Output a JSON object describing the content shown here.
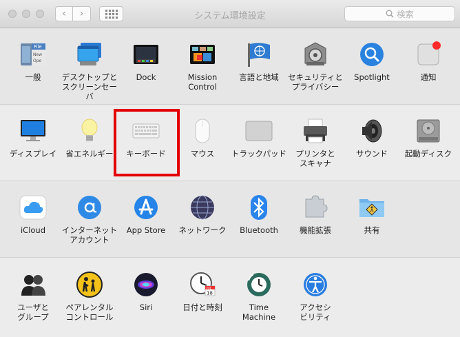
{
  "window": {
    "title": "システム環境設定"
  },
  "toolbar": {
    "back_label": "‹",
    "forward_label": "›",
    "search_placeholder": "検索"
  },
  "rows": [
    {
      "items": [
        {
          "id": "general",
          "label": "一般",
          "icon": "general-icon"
        },
        {
          "id": "desktop",
          "label": "デスクトップと\nスクリーンセーバ",
          "icon": "desktop-screensaver-icon"
        },
        {
          "id": "dock",
          "label": "Dock",
          "icon": "dock-icon"
        },
        {
          "id": "mission",
          "label": "Mission\nControl",
          "icon": "mission-control-icon"
        },
        {
          "id": "language",
          "label": "言語と地域",
          "icon": "language-region-icon"
        },
        {
          "id": "security",
          "label": "セキュリティと\nプライバシー",
          "icon": "security-privacy-icon"
        },
        {
          "id": "spotlight",
          "label": "Spotlight",
          "icon": "spotlight-icon"
        },
        {
          "id": "notifications",
          "label": "通知",
          "icon": "notifications-icon"
        }
      ]
    },
    {
      "items": [
        {
          "id": "displays",
          "label": "ディスプレイ",
          "icon": "display-icon"
        },
        {
          "id": "energy",
          "label": "省エネルギー",
          "icon": "energy-saver-icon"
        },
        {
          "id": "keyboard",
          "label": "キーボード",
          "icon": "keyboard-icon"
        },
        {
          "id": "mouse",
          "label": "マウス",
          "icon": "mouse-icon"
        },
        {
          "id": "trackpad",
          "label": "トラックパッド",
          "icon": "trackpad-icon"
        },
        {
          "id": "printers",
          "label": "プリンタと\nスキャナ",
          "icon": "printer-icon"
        },
        {
          "id": "sound",
          "label": "サウンド",
          "icon": "sound-icon"
        },
        {
          "id": "startup",
          "label": "起動ディスク",
          "icon": "startup-disk-icon"
        }
      ]
    },
    {
      "items": [
        {
          "id": "icloud",
          "label": "iCloud",
          "icon": "icloud-icon"
        },
        {
          "id": "internet",
          "label": "インターネット\nアカウント",
          "icon": "internet-accounts-icon"
        },
        {
          "id": "appstore",
          "label": "App Store",
          "icon": "app-store-icon"
        },
        {
          "id": "network",
          "label": "ネットワーク",
          "icon": "network-icon"
        },
        {
          "id": "bluetooth",
          "label": "Bluetooth",
          "icon": "bluetooth-icon"
        },
        {
          "id": "extensions",
          "label": "機能拡張",
          "icon": "extensions-icon"
        },
        {
          "id": "sharing",
          "label": "共有",
          "icon": "sharing-icon"
        }
      ]
    },
    {
      "items": [
        {
          "id": "users",
          "label": "ユーザと\nグループ",
          "icon": "users-groups-icon"
        },
        {
          "id": "parental",
          "label": "ペアレンタル\nコントロール",
          "icon": "parental-controls-icon"
        },
        {
          "id": "siri",
          "label": "Siri",
          "icon": "siri-icon"
        },
        {
          "id": "datetime",
          "label": "日付と時刻",
          "icon": "date-time-icon"
        },
        {
          "id": "timemachine",
          "label": "Time\nMachine",
          "icon": "time-machine-icon"
        },
        {
          "id": "accessibility",
          "label": "アクセシ\nビリティ",
          "icon": "accessibility-icon"
        }
      ]
    }
  ],
  "icon_text": {
    "general_file": "File",
    "general_new": "New",
    "general_open": "Ope",
    "calendar_month": "JUL",
    "calendar_day": "18"
  },
  "colors": {
    "highlight": "#e30000",
    "notification_dot": "#ff2a2a"
  }
}
